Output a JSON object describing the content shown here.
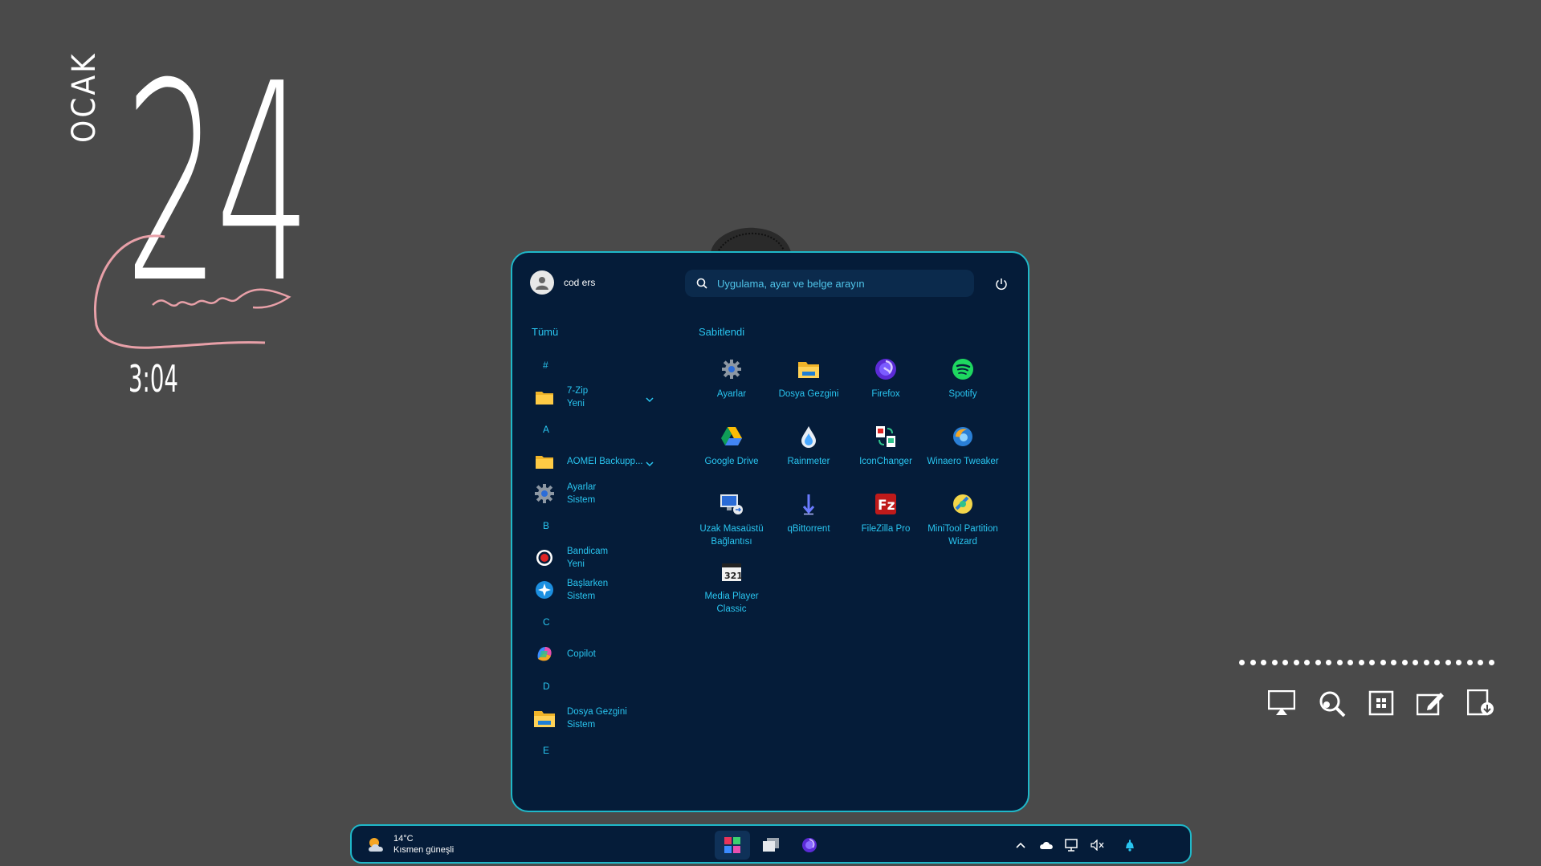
{
  "desktop": {
    "month": "OCAK",
    "day": "24",
    "time": "3:04"
  },
  "start_menu": {
    "user_name": "cod ers",
    "search_placeholder": "Uygulama, ayar ve belge arayın",
    "all_label": "Tümü",
    "pinned_label": "Sabitlendi",
    "app_list": [
      {
        "kind": "letter",
        "text": "#"
      },
      {
        "kind": "app",
        "name": "7-Zip",
        "sub": "Yeni",
        "icon": "folder-icon",
        "expandable": true
      },
      {
        "kind": "letter",
        "text": "A"
      },
      {
        "kind": "app",
        "name": "AOMEI Backupp...",
        "sub": "",
        "icon": "folder-icon",
        "expandable": true
      },
      {
        "kind": "app",
        "name": "Ayarlar",
        "sub": "Sistem",
        "icon": "gear-icon",
        "expandable": false
      },
      {
        "kind": "letter",
        "text": "B"
      },
      {
        "kind": "app",
        "name": "Bandicam",
        "sub": "Yeni",
        "icon": "record-icon",
        "expandable": false
      },
      {
        "kind": "app",
        "name": "Başlarken",
        "sub": "Sistem",
        "icon": "getstarted-icon",
        "expandable": false
      },
      {
        "kind": "letter",
        "text": "C"
      },
      {
        "kind": "app",
        "name": "Copilot",
        "sub": "",
        "icon": "copilot-icon",
        "expandable": false
      },
      {
        "kind": "letter",
        "text": "D"
      },
      {
        "kind": "app",
        "name": "Dosya Gezgini",
        "sub": "Sistem",
        "icon": "file-explorer-icon",
        "expandable": false
      },
      {
        "kind": "letter",
        "text": "E"
      }
    ],
    "pinned": [
      {
        "label": "Ayarlar",
        "icon": "gear-icon"
      },
      {
        "label": "Dosya Gezgini",
        "icon": "file-explorer-icon"
      },
      {
        "label": "Firefox",
        "icon": "firefox-icon"
      },
      {
        "label": "Spotify",
        "icon": "spotify-icon"
      },
      {
        "label": "Google Drive",
        "icon": "google-drive-icon"
      },
      {
        "label": "Rainmeter",
        "icon": "rainmeter-icon"
      },
      {
        "label": "IconChanger",
        "icon": "iconchanger-icon"
      },
      {
        "label": "Winaero Tweaker",
        "icon": "winaero-icon"
      },
      {
        "label": "Uzak Masaüstü Bağlantısı",
        "icon": "remote-desktop-icon"
      },
      {
        "label": "qBittorrent",
        "icon": "qbittorrent-icon"
      },
      {
        "label": "FileZilla Pro",
        "icon": "filezilla-icon"
      },
      {
        "label": "MiniTool Partition Wizard",
        "icon": "minitool-icon"
      },
      {
        "label": "Media Player Classic",
        "icon": "media-player-icon"
      }
    ]
  },
  "taskbar": {
    "temperature": "14°C",
    "weather_desc": "Kısmen güneşli"
  },
  "colors": {
    "accent": "#29c5f0",
    "border": "#1fb8c9",
    "panel": "#051c39",
    "desktop": "#4a4a4a"
  }
}
